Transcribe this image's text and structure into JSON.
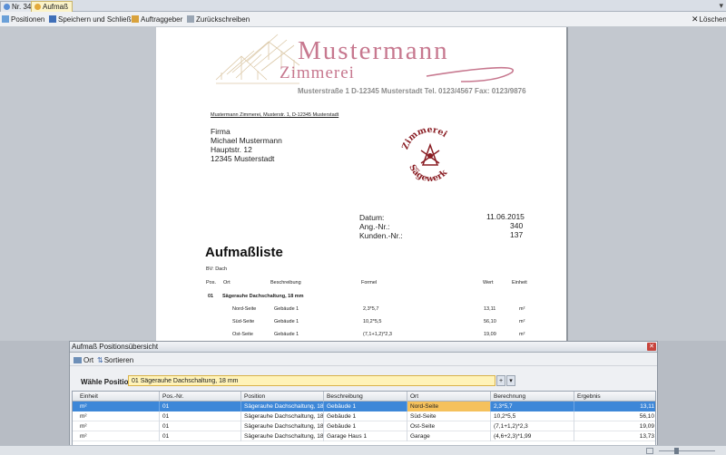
{
  "tabs": [
    {
      "label": "Nr. 340",
      "active": false
    },
    {
      "label": "Aufmaß",
      "active": true
    }
  ],
  "toolbar": {
    "positionen": "Positionen",
    "speichern": "Speichern und Schließen",
    "auftraggeber": "Auftraggeber",
    "zurueck": "Zurückschreiben",
    "loeschen": "Löschen"
  },
  "document": {
    "company_name": "Mustermann",
    "company_sub": "Zimmerei",
    "address_line": "Musterstraße 1   D-12345 Musterstadt   Tel. 0123/4567   Fax: 0123/9876",
    "sender_line": "Mustermann Zimmerei, Musterstr. 1, D-12345 Musterstadt",
    "recipient": [
      "Firma",
      "Michael Mustermann",
      "Hauptstr. 12",
      "12345 Musterstadt"
    ],
    "stamp_top": "Zimmerei",
    "stamp_bottom": "Sägewerk",
    "datum_label": "Datum:",
    "datum_value": "11.06.2015",
    "angnr_label": "Ang.-Nr.:",
    "angnr_value": "340",
    "kundennr_label": "Kunden.-Nr.:",
    "kundennr_value": "137",
    "title": "Aufmaßliste",
    "bv": "BV: Dach",
    "columns": {
      "pos": "Pos.",
      "ort": "Ort",
      "beschreibung": "Beschreibung",
      "formel": "Formel",
      "wert": "Wert",
      "einheit": "Einheit"
    },
    "group": {
      "pos": "01",
      "title": "Sägerauhe Dachschaltung, 18 mm"
    },
    "rows": [
      {
        "ort": "Nord-Seite",
        "beschreibung": "Gebäude 1",
        "formel": "2,3*5,7",
        "wert": "13,11",
        "einheit": "m²"
      },
      {
        "ort": "Süd-Seite",
        "beschreibung": "Gebäude 1",
        "formel": "10,2*5,5",
        "wert": "56,10",
        "einheit": "m²"
      },
      {
        "ort": "Ost-Seite",
        "beschreibung": "Gebäude 1",
        "formel": "(7,1+1,2)*2,3",
        "wert": "19,09",
        "einheit": "m²"
      }
    ]
  },
  "panel": {
    "title": "Aufmaß Positionsübersicht",
    "tool_ort": "Ort",
    "tool_sortieren": "Sortieren",
    "select_label": "Wähle Position:",
    "select_value": "01 Sägerauhe Dachschaltung, 18 mm",
    "grid_headers": [
      "Einheit",
      "Pos.-Nr.",
      "Position",
      "Beschreibung",
      "Ort",
      "Berechnung",
      "Ergebnis"
    ],
    "grid_rows": [
      [
        "m²",
        "01",
        "Sägerauhe Dachschaltung, 18...",
        "Gebäude 1",
        "Nord-Seite",
        "2,3*5,7",
        "13,11"
      ],
      [
        "m²",
        "01",
        "Sägerauhe Dachschaltung, 18...",
        "Gebäude 1",
        "Süd-Seite",
        "10,2*5,5",
        "56,10"
      ],
      [
        "m²",
        "01",
        "Sägerauhe Dachschaltung, 18...",
        "Gebäude 1",
        "Ost-Seite",
        "(7,1+1,2)*2,3",
        "19,09"
      ],
      [
        "m²",
        "01",
        "Sägerauhe Dachschaltung, 18...",
        "Garage Haus 1",
        "Garage",
        "(4,6+2,3)*1,99",
        "13,73"
      ]
    ]
  },
  "colors": {
    "accent": "#3d87d8",
    "brand": "#c7788f",
    "highlight": "#f5c15c"
  }
}
